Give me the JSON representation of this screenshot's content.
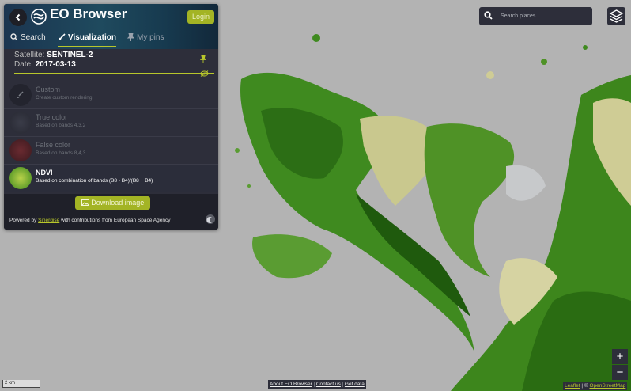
{
  "app": {
    "title": "EO Browser",
    "login_label": "Login"
  },
  "tabs": [
    {
      "label": "Search"
    },
    {
      "label": "Visualization"
    },
    {
      "label": "My pins"
    }
  ],
  "info": {
    "satellite_label": "Satellite:",
    "satellite": "SENTINEL-2",
    "date_label": "Date:",
    "date": "2017-03-13"
  },
  "options": [
    {
      "name": "Custom",
      "desc": "Create custom rendering"
    },
    {
      "name": "True color",
      "desc": "Based on bands 4,3,2"
    },
    {
      "name": "False color",
      "desc": "Based on bands 8,4,3"
    },
    {
      "name": "NDVI",
      "desc": "Based on combination of bands (B8 - B4)/(B8 + B4)"
    }
  ],
  "download_label": "Download image",
  "footer": {
    "powered": "Powered by",
    "sinergise": "Sinergise",
    "rest": "with contributions from European Space Agency"
  },
  "search": {
    "placeholder": "Search places"
  },
  "zoom": {
    "in": "+",
    "out": "−"
  },
  "scale": "2 km",
  "links": [
    "About EO Browser",
    "Contact us",
    "Get data"
  ],
  "attribution": {
    "leaflet": "Leaflet",
    "sep": " | © ",
    "osm": "OpenStreetMap"
  },
  "colors": {
    "accent": "#b8c72b",
    "panel": "#2d2e3a",
    "map_bg": "#b3b3b3"
  }
}
